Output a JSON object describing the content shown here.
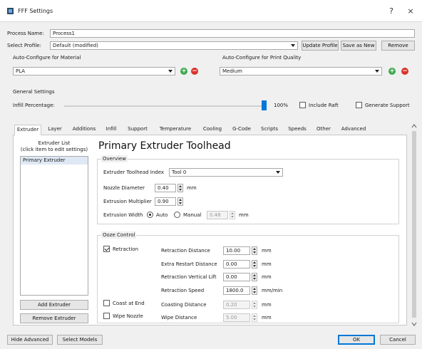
{
  "window": {
    "title": "FFF Settings",
    "help_glyph": "?",
    "close_glyph": "×"
  },
  "process": {
    "name_label": "Process Name:",
    "name_value": "Process1",
    "profile_label": "Select Profile:",
    "profile_value": "Default (modified)",
    "update_profile": "Update Profile",
    "save_as_new": "Save as New",
    "remove": "Remove"
  },
  "material": {
    "label": "Auto-Configure for Material",
    "value": "PLA"
  },
  "quality": {
    "label": "Auto-Configure for Print Quality",
    "value": "Medium"
  },
  "general": {
    "label": "General Settings",
    "infill_label": "Infill Percentage:",
    "infill_value": "100%",
    "infill_fraction": 1.0,
    "include_raft": "Include Raft",
    "generate_support": "Generate Support"
  },
  "tabs": [
    "Extruder",
    "Layer",
    "Additions",
    "Infill",
    "Support",
    "Temperature",
    "Cooling",
    "G-Code",
    "Scripts",
    "Speeds",
    "Other",
    "Advanced"
  ],
  "extruder_list": {
    "header_line1": "Extruder List",
    "header_line2": "(click item to edit settings)",
    "items": [
      "Primary Extruder"
    ],
    "add_button": "Add Extruder",
    "remove_button": "Remove Extruder"
  },
  "toolhead": {
    "heading": "Primary Extruder Toolhead",
    "overview_label": "Overview",
    "index_label": "Extruder Toolhead Index",
    "index_value": "Tool 0",
    "nozzle_label": "Nozzle Diameter",
    "nozzle_value": "0.40",
    "nozzle_unit": "mm",
    "multiplier_label": "Extrusion Multiplier",
    "multiplier_value": "0.90",
    "width_label": "Extrusion Width",
    "width_auto": "Auto",
    "width_manual": "Manual",
    "width_value": "0.48",
    "width_unit": "mm"
  },
  "ooze": {
    "label": "Ooze Control",
    "retraction_label": "Retraction",
    "distance_label": "Retraction Distance",
    "distance_value": "10.00",
    "distance_unit": "mm",
    "extra_restart_label": "Extra Restart Distance",
    "extra_restart_value": "0.00",
    "extra_restart_unit": "mm",
    "vertical_lift_label": "Retraction Vertical Lift",
    "vertical_lift_value": "0.00",
    "vertical_lift_unit": "mm",
    "speed_label": "Retraction Speed",
    "speed_value": "1800.0",
    "speed_unit": "mm/min",
    "coast_label": "Coast at End",
    "coasting_distance_label": "Coasting Distance",
    "coasting_distance_value": "0.20",
    "coasting_distance_unit": "mm",
    "wipe_label": "Wipe Nozzle",
    "wipe_distance_label": "Wipe Distance",
    "wipe_distance_value": "5.00",
    "wipe_distance_unit": "mm"
  },
  "footer": {
    "hide_advanced": "Hide Advanced",
    "select_models": "Select Models",
    "ok": "OK",
    "cancel": "Cancel"
  },
  "colors": {
    "accent": "#0078d7",
    "add": "#3aa84a",
    "remove": "#d9342b"
  }
}
